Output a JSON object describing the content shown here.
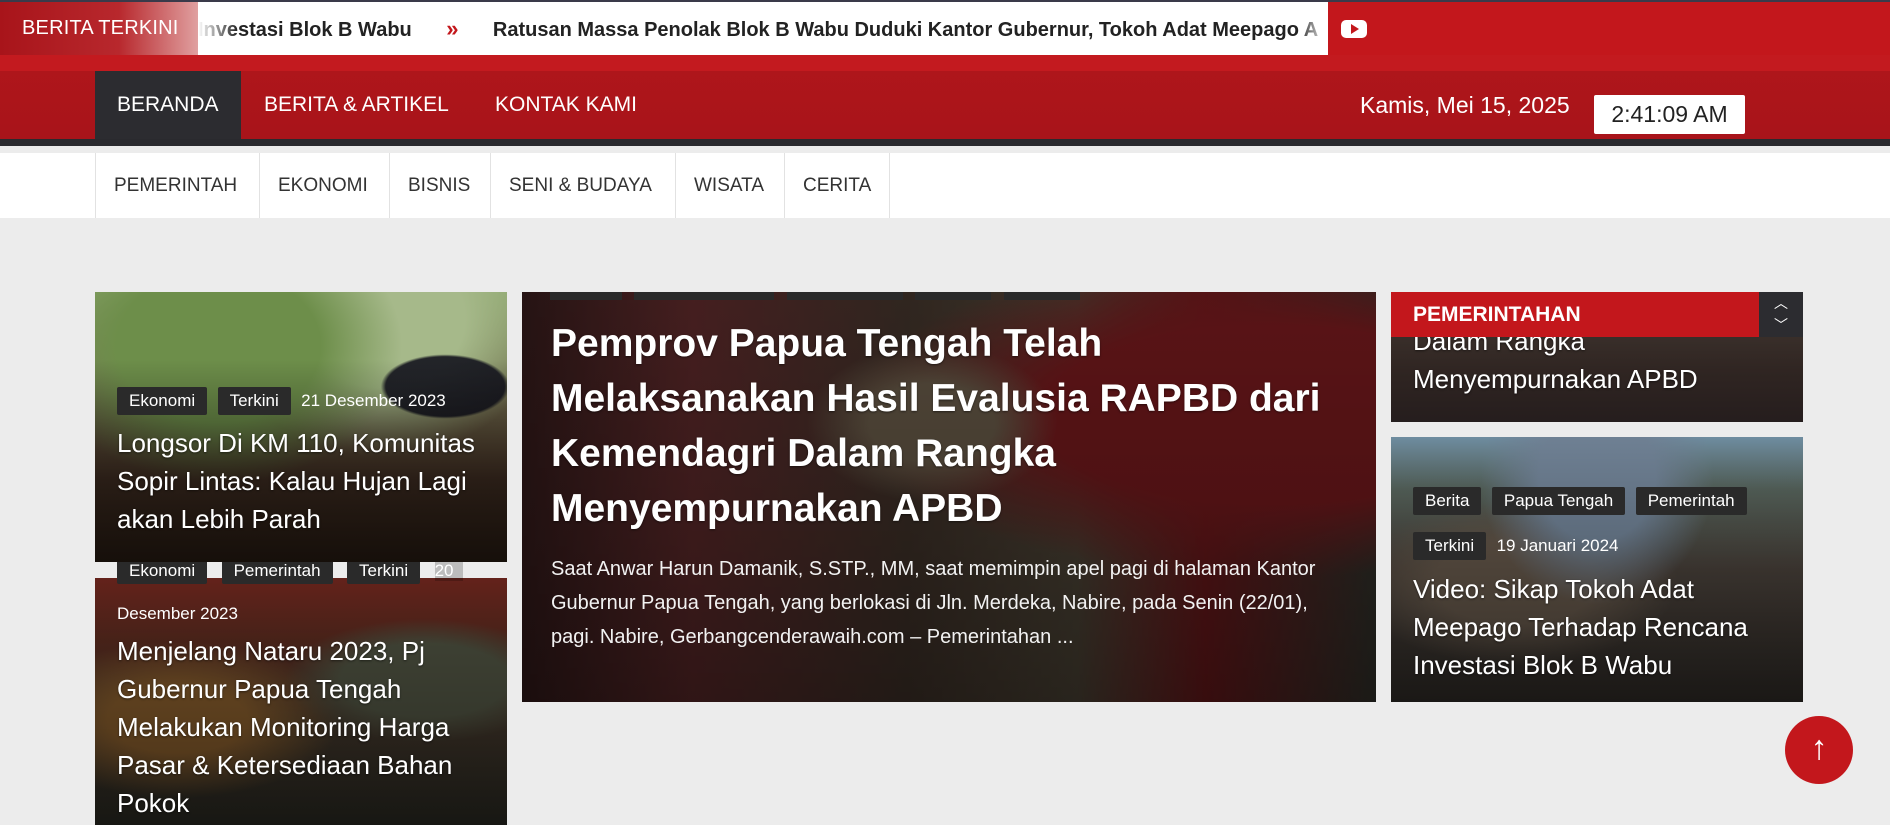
{
  "ticker": {
    "label": "BERITA TERKINI",
    "items": [
      "Investasi Blok B Wabu",
      "Ratusan Massa Penolak Blok B Wabu Duduki Kantor Gubernur, Tokoh Adat Meepago A"
    ],
    "separator": "»"
  },
  "mainnav": {
    "items": [
      "BERANDA",
      "BERITA & ARTIKEL",
      "KONTAK KAMI"
    ],
    "active": "BERANDA",
    "date": "Kamis, Mei 15, 2025",
    "time": "2:41:09 AM"
  },
  "subnav": {
    "items": [
      "PEMERINTAH",
      "EKONOMI",
      "BISNIS",
      "SENI & BUDAYA",
      "WISATA",
      "CERITA"
    ]
  },
  "left_cards": [
    {
      "tags": [
        "Ekonomi",
        "Terkini"
      ],
      "date": "21 Desember 2023",
      "title": "Longsor Di KM 110, Komunitas Sopir Lintas: Kalau Hujan Lagi akan Lebih Parah"
    },
    {
      "tags": [
        "Ekonomi",
        "Pemerintah",
        "Terkini"
      ],
      "date_part1": "20",
      "date_part2": "Desember 2023",
      "title": "Menjelang Nataru 2023, Pj Gubernur Papua Tengah Melakukan Monitoring Harga Pasar & Ketersediaan Bahan Pokok"
    }
  ],
  "featured": {
    "title": "Pemprov Papua Tengah Telah Melaksanakan Hasil Evalusia RAPBD dari Kemendagri Dalam Rangka Menyempurnakan APBD",
    "excerpt": "Saat Anwar Harun Damanik, S.STP., MM, saat memimpin apel pagi di halaman Kantor Gubernur Papua Tengah, yang berlokasi di Jln. Merdeka, Nabire, pada Senin (22/01), pagi. Nabire, Gerbangcenderawaih.com – Pemerintahan ..."
  },
  "right_section": {
    "heading": "PEMERINTAHAN",
    "top_card_title": "Dalam Rangka Menyempurnakan APBD",
    "bottom_card": {
      "tags": [
        "Berita",
        "Papua Tengah",
        "Pemerintah"
      ],
      "tags2": [
        "Terkini"
      ],
      "date": "19 Januari 2024",
      "title": "Video: Sikap Tokoh Adat Meepago Terhadap Rencana Investasi Blok B Wabu"
    }
  },
  "icons": {
    "youtube": "youtube-icon",
    "totop": "arrow-up-icon",
    "up": "chevron-up-icon",
    "down": "chevron-down-icon"
  },
  "colors": {
    "brand_red": "#c3171c",
    "dark": "#2c2c30"
  }
}
